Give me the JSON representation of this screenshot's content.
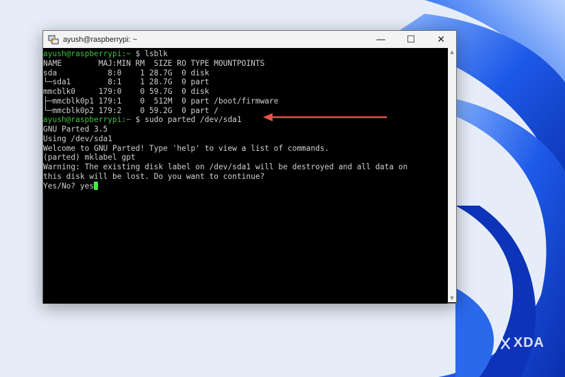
{
  "window": {
    "title": "ayush@raspberrypi: ~",
    "controls": {
      "minimize": "—",
      "maximize": "☐",
      "close": "✕"
    }
  },
  "terminal": {
    "lines": [
      {
        "prompt": "ayush@raspberrypi:~",
        "sep": " $ ",
        "cmd": "lsblk"
      },
      {
        "text": "NAME        MAJ:MIN RM  SIZE RO TYPE MOUNTPOINTS"
      },
      {
        "text": "sda           8:0    1 28.7G  0 disk"
      },
      {
        "text": "└─sda1        8:1    1 28.7G  0 part"
      },
      {
        "text": "mmcblk0     179:0    0 59.7G  0 disk"
      },
      {
        "text": "├─mmcblk0p1 179:1    0  512M  0 part /boot/firmware"
      },
      {
        "text": "└─mmcblk0p2 179:2    0 59.2G  0 part /"
      },
      {
        "prompt": "ayush@raspberrypi:~",
        "sep": " $ ",
        "cmd": "sudo parted /dev/sda1"
      },
      {
        "text": "GNU Parted 3.5"
      },
      {
        "text": "Using /dev/sda1"
      },
      {
        "text": "Welcome to GNU Parted! Type 'help' to view a list of commands."
      },
      {
        "text": "(parted) mklabel gpt"
      },
      {
        "text": "Warning: The existing disk label on /dev/sda1 will be destroyed and all data on"
      },
      {
        "text": "this disk will be lost. Do you want to continue?"
      },
      {
        "text": "Yes/No? yes",
        "cursor": true
      }
    ]
  },
  "annotation": {
    "arrow_color": "#e8514a"
  },
  "watermark": {
    "text": "XDA"
  },
  "colors": {
    "prompt": "#3ec33e",
    "cursor": "#3df23d",
    "terminal_bg": "#000000",
    "text": "#d0d0d0"
  }
}
